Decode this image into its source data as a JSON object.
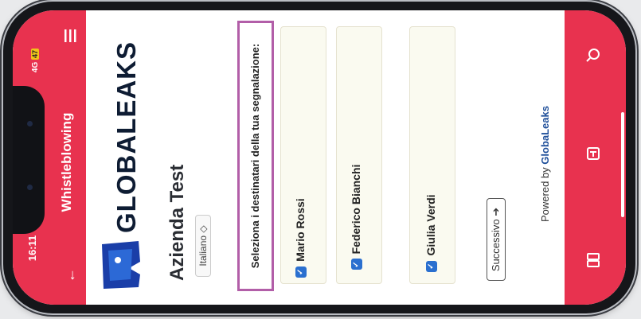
{
  "status": {
    "time": "16:11",
    "network": "4G",
    "battery": "47"
  },
  "header": {
    "title": "Whistleblowing"
  },
  "brand": {
    "logo_text": "GLOBALEAKS",
    "company_name": "Azienda Test"
  },
  "language": {
    "selected": "Italiano",
    "icon": "chevron-updown-icon"
  },
  "main": {
    "prompt": "Seleziona i destinatari della tua segnalazione:",
    "recipients": [
      {
        "name": "Mario Rossi"
      },
      {
        "name": "Federico Bianchi"
      },
      {
        "name": "Giulia Verdi"
      }
    ],
    "next_label": "Successivo"
  },
  "footer": {
    "prefix": "Powered by",
    "brand": "GlobaLeaks"
  },
  "nav_icons": [
    "back-arrow-icon",
    "menu-icon",
    "search-icon",
    "tabs-icon",
    "reader-mode-icon"
  ],
  "colors": {
    "accent": "#e8324f",
    "logo": "#0e1c33",
    "highlight": "#b25ea8",
    "check": "#2a6fcf"
  }
}
